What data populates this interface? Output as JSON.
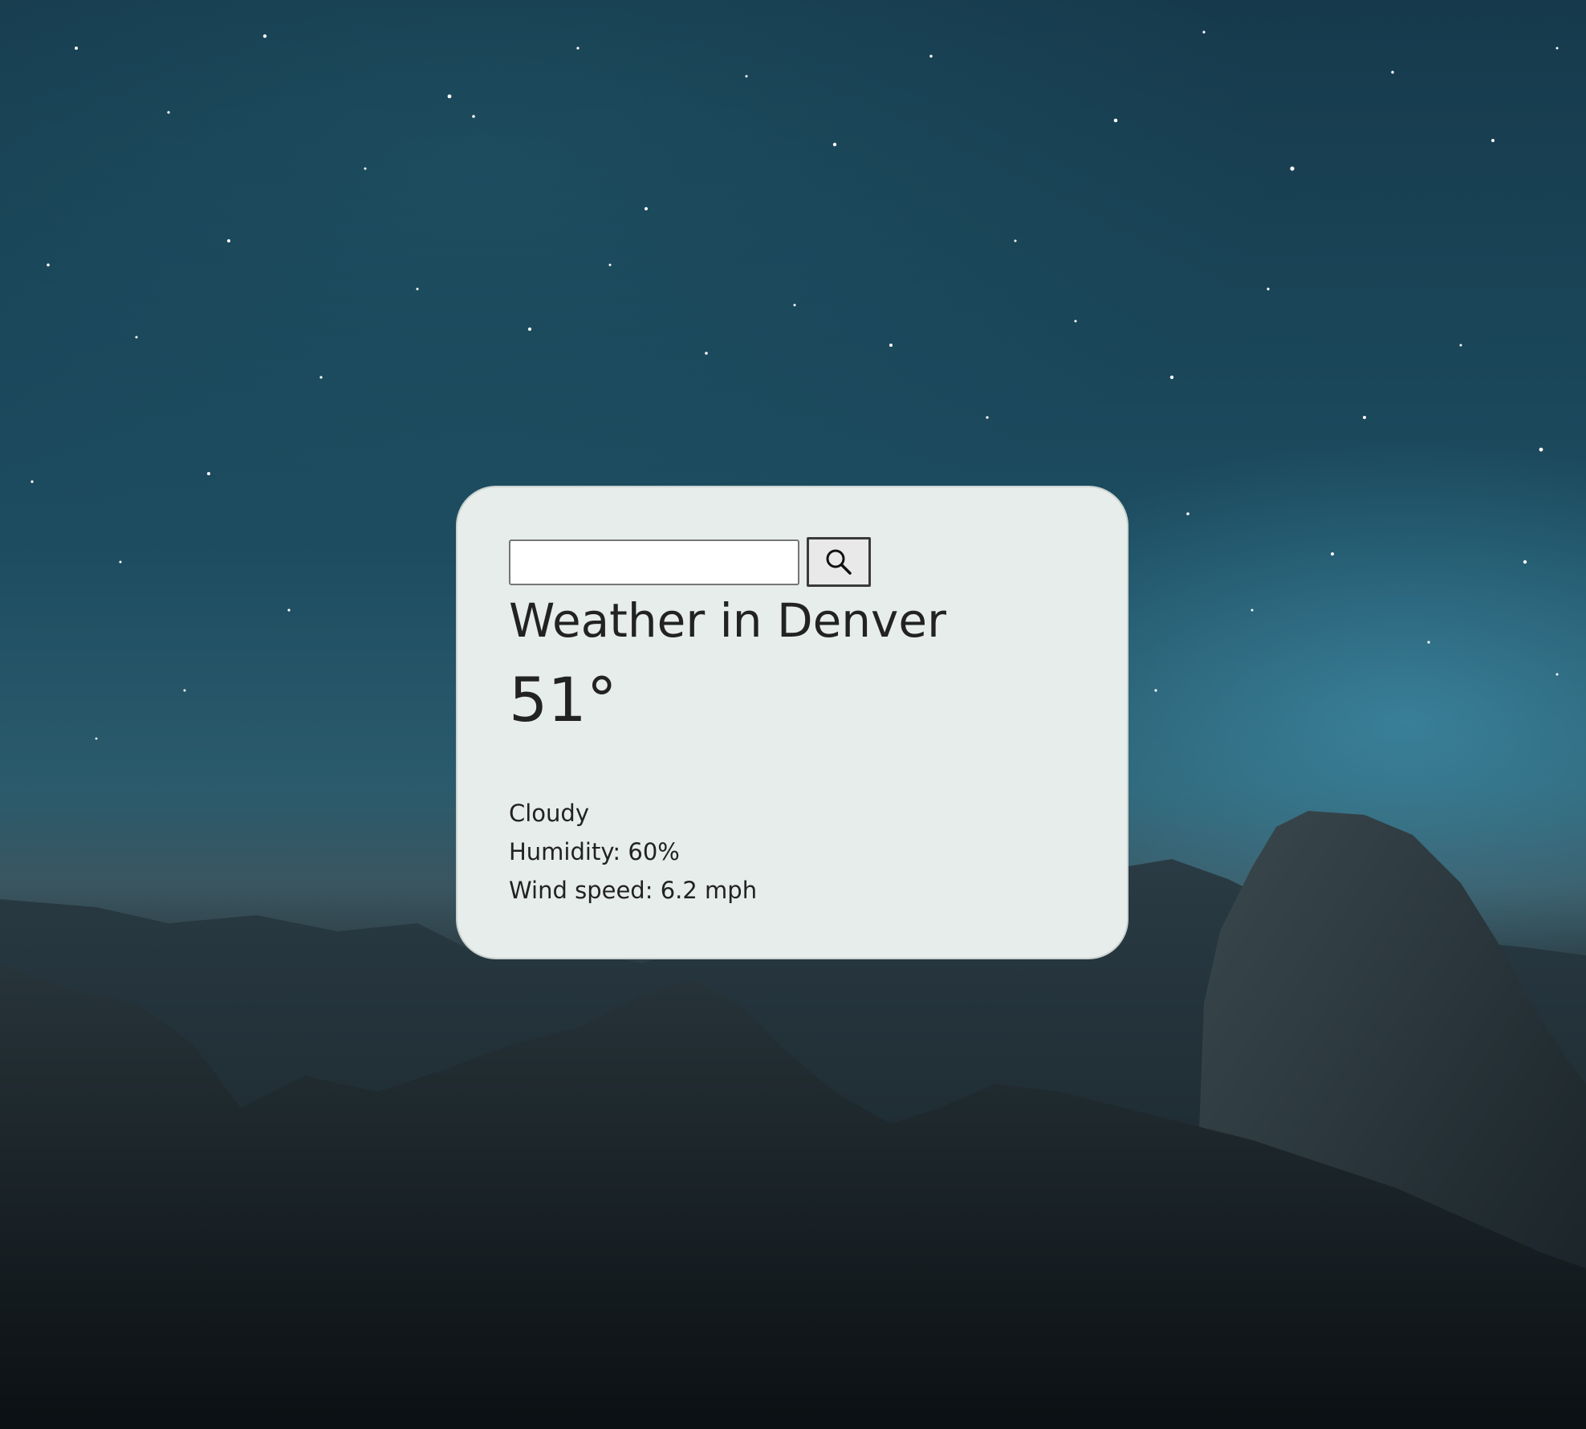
{
  "search": {
    "value": "",
    "placeholder": ""
  },
  "weather": {
    "city_heading": "Weather in Denver",
    "temperature": "51°",
    "description": "Cloudy",
    "humidity": "Humidity: 60%",
    "wind": "Wind speed: 6.2 mph"
  },
  "icons": {
    "search_button": "search-icon"
  },
  "colors": {
    "card_background": "#e6edea",
    "text": "#222222"
  }
}
